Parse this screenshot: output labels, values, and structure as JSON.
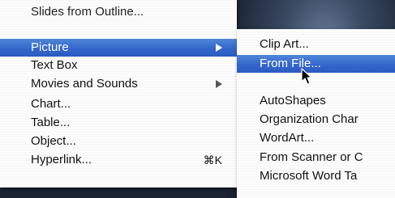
{
  "main_menu": {
    "items": [
      {
        "label": "Slides from Outline...",
        "state": "normal"
      },
      {
        "label": "Picture",
        "state": "highlighted",
        "submenu": true
      },
      {
        "label": "Text Box",
        "state": "normal"
      },
      {
        "label": "Movies and Sounds",
        "state": "normal",
        "submenu": true
      },
      {
        "label": "Chart...",
        "state": "normal"
      },
      {
        "label": "Table...",
        "state": "normal"
      },
      {
        "label": "Object...",
        "state": "normal"
      },
      {
        "label": "Hyperlink...",
        "state": "normal",
        "shortcut": "⌘K"
      }
    ]
  },
  "picture_submenu": {
    "items": [
      {
        "label": "Clip Art...",
        "state": "normal"
      },
      {
        "label": "From File...",
        "state": "highlighted"
      },
      {
        "label": "AutoShapes",
        "state": "normal"
      },
      {
        "label": "Organization Char",
        "state": "normal"
      },
      {
        "label": "WordArt...",
        "state": "normal"
      },
      {
        "label": "From Scanner or C",
        "state": "normal"
      },
      {
        "label": "Microsoft Word Ta",
        "state": "normal"
      }
    ]
  },
  "cursor": {
    "icon": "arrow-pointer-icon"
  },
  "colors": {
    "highlight": "#3366cc",
    "menu_background": "#ffffff"
  }
}
